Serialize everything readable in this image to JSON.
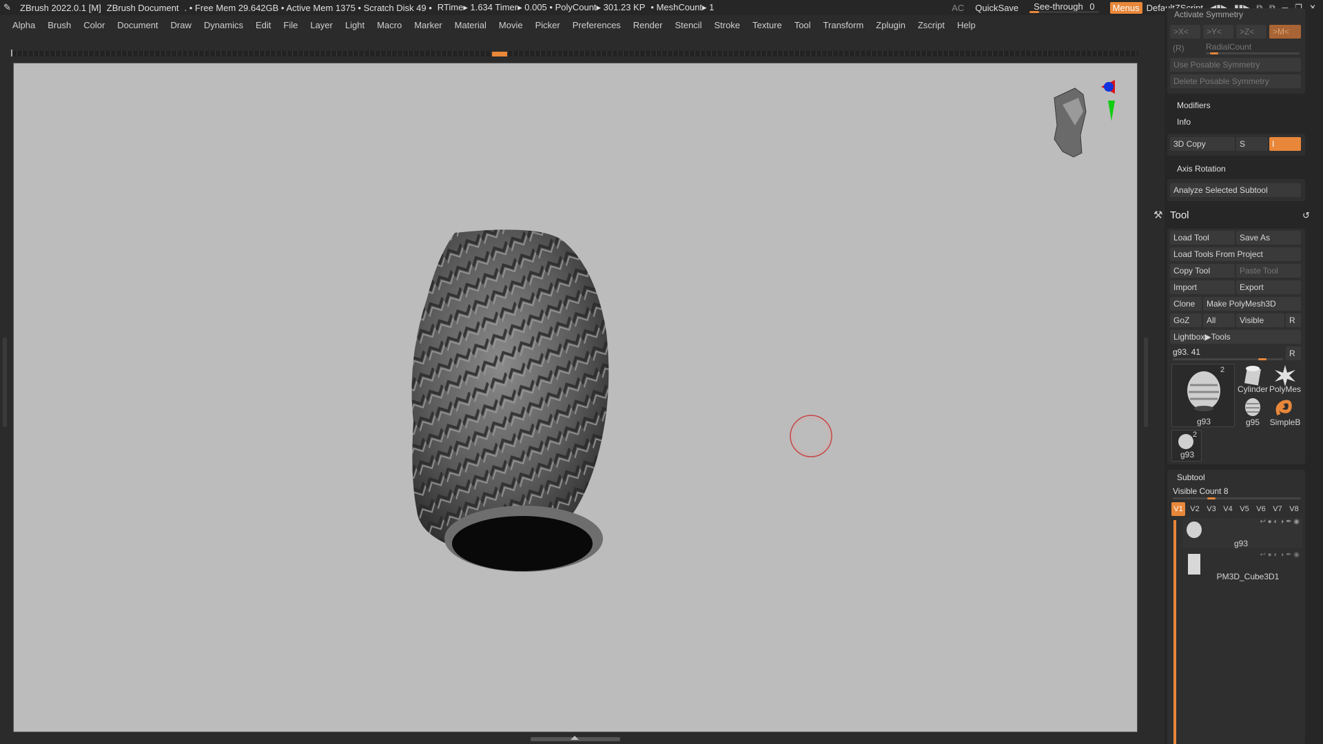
{
  "titlebar": {
    "app": "ZBrush 2022.0.1 [M]",
    "document": "ZBrush Document",
    "stats": ". • Free Mem 29.642GB • Active Mem 1375 • Scratch Disk 49 •",
    "timing": "RTime▸ 1.634 Timer▸ 0.005 • PolyCount▸ 301.23 KP",
    "meshcount": "• MeshCount▸ 1",
    "ac": "AC",
    "quicksave": "QuickSave",
    "see_through_label": "See-through",
    "see_through_value": "0",
    "menus": "Menus",
    "script": "DefaultZScript"
  },
  "menubar": [
    "Alpha",
    "Brush",
    "Color",
    "Document",
    "Draw",
    "Dynamics",
    "Edit",
    "File",
    "Layer",
    "Light",
    "Macro",
    "Marker",
    "Material",
    "Movie",
    "Picker",
    "Preferences",
    "Render",
    "Stencil",
    "Stroke",
    "Texture",
    "Tool",
    "Transform",
    "Zplugin",
    "Zscript",
    "Help"
  ],
  "symmetry": {
    "title": "Activate Symmetry",
    "x": ">X<",
    "y": ">Y<",
    "z": ">Z<",
    "m": ">M<",
    "r": "(R)",
    "radial": "RadialCount",
    "use_posable": "Use Posable Symmetry",
    "delete_posable": "Delete Posable Symmetry"
  },
  "sections": {
    "modifiers": "Modifiers",
    "info": "Info",
    "copy3d": "3D Copy",
    "s_label": "S",
    "s_value": "I",
    "axis_rotation": "Axis Rotation",
    "analyze": "Analyze Selected Subtool"
  },
  "tool": {
    "title": "Tool",
    "load_tool": "Load Tool",
    "save_as": "Save As",
    "load_from_project": "Load Tools From Project",
    "copy_tool": "Copy Tool",
    "paste_tool": "Paste Tool",
    "import": "Import",
    "export": "Export",
    "clone": "Clone",
    "make_polymesh": "Make PolyMesh3D",
    "goz": "GoZ",
    "all": "All",
    "visible": "Visible",
    "r": "R",
    "lightbox": "Lightbox▶Tools",
    "current": "g93. 41",
    "current_r": "R",
    "thumbs": [
      {
        "label": "g93",
        "count": "2"
      },
      {
        "label": "Cylinder"
      },
      {
        "label": "PolyMes"
      },
      {
        "label": "g95"
      },
      {
        "label": "SimpleB"
      },
      {
        "label": "g93",
        "count": "2"
      }
    ]
  },
  "subtool": {
    "title": "Subtool",
    "visible_count": "Visible Count 8",
    "tabs": [
      "V1",
      "V2",
      "V3",
      "V4",
      "V5",
      "V6",
      "V7",
      "V8"
    ],
    "active_tab": "V1",
    "items": [
      {
        "name": "g93"
      },
      {
        "name": "PM3D_Cube3D1"
      }
    ]
  }
}
